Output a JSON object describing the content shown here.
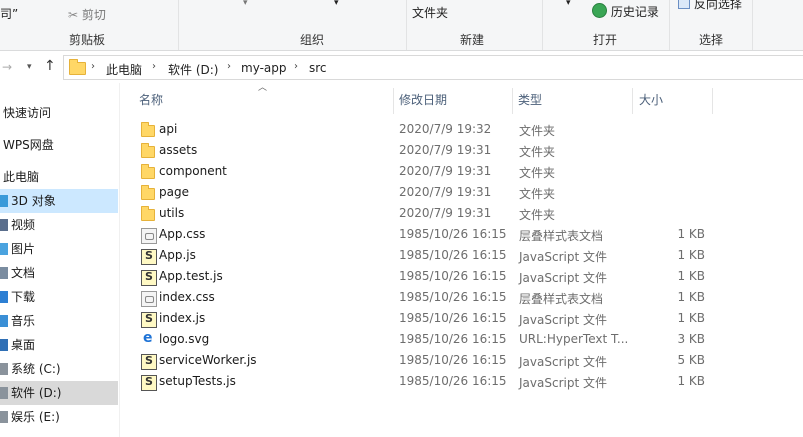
{
  "ribbon": {
    "clip_label": "司”",
    "cut_label": "剪切",
    "clipboard_group": "剪贴板",
    "organize_group": "组织",
    "new_folder_label": "文件夹",
    "new_group": "新建",
    "history_label": "历史记录",
    "open_group": "打开",
    "invert_label": "反向选择",
    "select_group": "选择"
  },
  "address": {
    "crumbs": [
      "此电脑",
      "软件 (D:)",
      "my-app",
      "src"
    ]
  },
  "nav": {
    "items": [
      {
        "label": "快速访问",
        "icon": "star-icon",
        "state": ""
      },
      {
        "label": "WPS网盘",
        "icon": "cloud-icon",
        "state": ""
      },
      {
        "label": "此电脑",
        "icon": "computer-icon",
        "state": ""
      },
      {
        "label": "3D 对象",
        "icon": "3d-objects-icon",
        "state": "selected"
      },
      {
        "label": "视频",
        "icon": "video-icon",
        "state": ""
      },
      {
        "label": "图片",
        "icon": "picture-icon",
        "state": ""
      },
      {
        "label": "文档",
        "icon": "document-icon",
        "state": ""
      },
      {
        "label": "下载",
        "icon": "download-icon",
        "state": ""
      },
      {
        "label": "音乐",
        "icon": "music-icon",
        "state": ""
      },
      {
        "label": "桌面",
        "icon": "desktop-icon",
        "state": ""
      },
      {
        "label": "系统 (C:)",
        "icon": "drive-icon",
        "state": ""
      },
      {
        "label": "软件 (D:)",
        "icon": "drive-icon",
        "state": "current"
      },
      {
        "label": "娱乐 (E:)",
        "icon": "drive-icon",
        "state": ""
      }
    ]
  },
  "columns": {
    "name": "名称",
    "date": "修改日期",
    "type": "类型",
    "size": "大小"
  },
  "files": [
    {
      "name": "api",
      "date": "2020/7/9 19:32",
      "type": "文件夹",
      "size": "",
      "kind": "folder"
    },
    {
      "name": "assets",
      "date": "2020/7/9 19:31",
      "type": "文件夹",
      "size": "",
      "kind": "folder"
    },
    {
      "name": "component",
      "date": "2020/7/9 19:31",
      "type": "文件夹",
      "size": "",
      "kind": "folder"
    },
    {
      "name": "page",
      "date": "2020/7/9 19:31",
      "type": "文件夹",
      "size": "",
      "kind": "folder"
    },
    {
      "name": "utils",
      "date": "2020/7/9 19:31",
      "type": "文件夹",
      "size": "",
      "kind": "folder"
    },
    {
      "name": "App.css",
      "date": "1985/10/26 16:15",
      "type": "层叠样式表文档",
      "size": "1 KB",
      "kind": "css"
    },
    {
      "name": "App.js",
      "date": "1985/10/26 16:15",
      "type": "JavaScript 文件",
      "size": "1 KB",
      "kind": "js"
    },
    {
      "name": "App.test.js",
      "date": "1985/10/26 16:15",
      "type": "JavaScript 文件",
      "size": "1 KB",
      "kind": "js"
    },
    {
      "name": "index.css",
      "date": "1985/10/26 16:15",
      "type": "层叠样式表文档",
      "size": "1 KB",
      "kind": "css"
    },
    {
      "name": "index.js",
      "date": "1985/10/26 16:15",
      "type": "JavaScript 文件",
      "size": "1 KB",
      "kind": "js"
    },
    {
      "name": "logo.svg",
      "date": "1985/10/26 16:15",
      "type": "URL:HyperText T...",
      "size": "3 KB",
      "kind": "svg"
    },
    {
      "name": "serviceWorker.js",
      "date": "1985/10/26 16:15",
      "type": "JavaScript 文件",
      "size": "5 KB",
      "kind": "js"
    },
    {
      "name": "setupTests.js",
      "date": "1985/10/26 16:15",
      "type": "JavaScript 文件",
      "size": "1 KB",
      "kind": "js"
    }
  ]
}
